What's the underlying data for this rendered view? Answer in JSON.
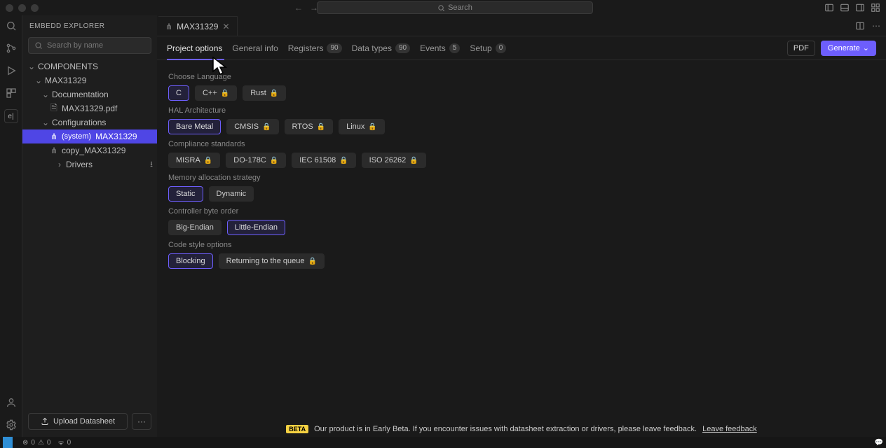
{
  "titlebar": {
    "search_label": "Search"
  },
  "sidebar": {
    "title": "EMBEDD EXPLORER",
    "search_placeholder": "Search by name",
    "tree": {
      "root": "COMPONENTS",
      "n1": "MAX31329",
      "n2": "Documentation",
      "n3": "MAX31329.pdf",
      "n4": "Configurations",
      "n5_prefix": "(system)",
      "n5": "MAX31329",
      "n6": "copy_MAX31329",
      "n7": "Drivers"
    },
    "upload": "Upload Datasheet",
    "more": "···"
  },
  "tab": {
    "title": "MAX31329"
  },
  "subtabs": {
    "project_options": "Project options",
    "general_info": "General info",
    "registers": "Registers",
    "registers_n": "90",
    "data_types": "Data types",
    "data_types_n": "90",
    "events": "Events",
    "events_n": "5",
    "setup": "Setup",
    "setup_n": "0",
    "pdf": "PDF",
    "generate": "Generate"
  },
  "options": {
    "lang_label": "Choose Language",
    "lang": {
      "c": "C",
      "cpp": "C++",
      "rust": "Rust"
    },
    "hal_label": "HAL Architecture",
    "hal": {
      "bare": "Bare Metal",
      "cmsis": "CMSIS",
      "rtos": "RTOS",
      "linux": "Linux"
    },
    "compliance_label": "Compliance standards",
    "compliance": {
      "misra": "MISRA",
      "do": "DO-178C",
      "iec": "IEC 61508",
      "iso": "ISO 26262"
    },
    "mem_label": "Memory allocation strategy",
    "mem": {
      "static": "Static",
      "dynamic": "Dynamic"
    },
    "byte_label": "Controller byte order",
    "byte": {
      "big": "Big-Endian",
      "little": "Little-Endian"
    },
    "code_label": "Code style options",
    "code": {
      "blocking": "Blocking",
      "queue": "Returning to the queue"
    }
  },
  "banner": {
    "beta": "BETA",
    "text": "Our product is in Early Beta. If you encounter issues with datasheet extraction or drivers, please leave feedback.",
    "link": "Leave feedback"
  },
  "status": {
    "errors": "0",
    "warnings": "0",
    "ports": "0"
  }
}
